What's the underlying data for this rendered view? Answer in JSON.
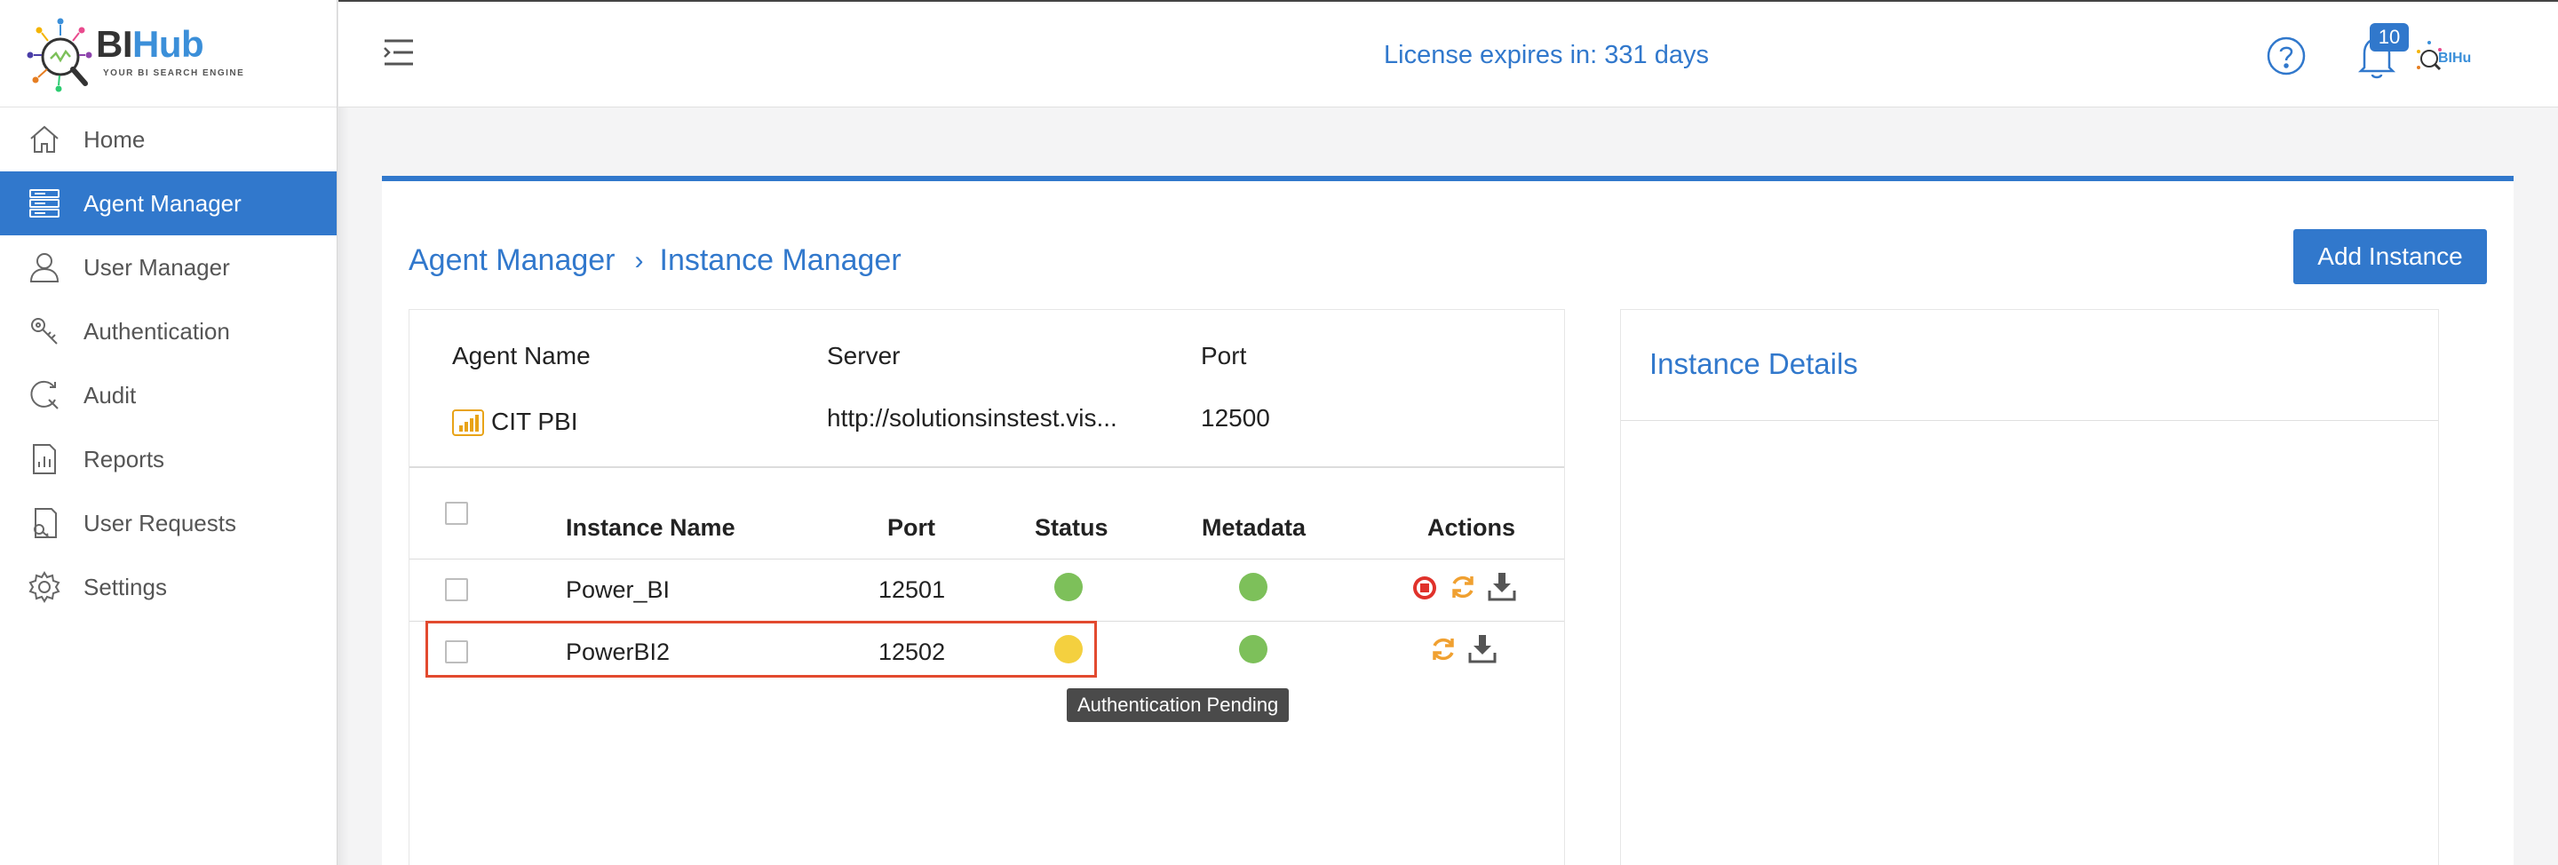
{
  "brand": {
    "name_part1": "BI",
    "name_part2": "Hub",
    "tagline": "YOUR BI SEARCH ENGINE"
  },
  "sidebar": {
    "items": [
      {
        "label": "Home",
        "icon": "home-icon",
        "active": false
      },
      {
        "label": "Agent Manager",
        "icon": "server-icon",
        "active": true
      },
      {
        "label": "User Manager",
        "icon": "user-icon",
        "active": false
      },
      {
        "label": "Authentication",
        "icon": "key-icon",
        "active": false
      },
      {
        "label": "Audit",
        "icon": "search-audit-icon",
        "active": false
      },
      {
        "label": "Reports",
        "icon": "report-icon",
        "active": false
      },
      {
        "label": "User Requests",
        "icon": "request-icon",
        "active": false
      },
      {
        "label": "Settings",
        "icon": "gear-icon",
        "active": false
      }
    ]
  },
  "header": {
    "license_text": "License expires in: 331 days",
    "notification_count": "10"
  },
  "breadcrumb": {
    "parent": "Agent Manager",
    "current": "Instance Manager"
  },
  "actions": {
    "add_instance_label": "Add Instance"
  },
  "agent": {
    "headers": {
      "name": "Agent Name",
      "server": "Server",
      "port": "Port"
    },
    "name": "CIT PBI",
    "server": "http://solutionsinstest.vis...",
    "port": "12500"
  },
  "instances": {
    "columns": [
      "Instance Name",
      "Port",
      "Status",
      "Metadata",
      "Actions"
    ],
    "rows": [
      {
        "name": "Power_BI",
        "port": "12501",
        "status_color": "#7dc05a",
        "metadata_color": "#7dc05a",
        "actions": [
          "stop-icon",
          "refresh-icon",
          "download-icon"
        ]
      },
      {
        "name": "PowerBI2",
        "port": "12502",
        "status_color": "#f4d03f",
        "metadata_color": "#7dc05a",
        "actions": [
          "refresh-icon",
          "download-icon"
        ]
      }
    ]
  },
  "tooltip": "Authentication Pending",
  "details": {
    "title": "Instance Details"
  },
  "colors": {
    "accent": "#3178cc",
    "success": "#7dc05a",
    "warning": "#f4d03f",
    "danger": "#e0322b",
    "refresh": "#f0a030",
    "highlight": "#e24a2f"
  }
}
